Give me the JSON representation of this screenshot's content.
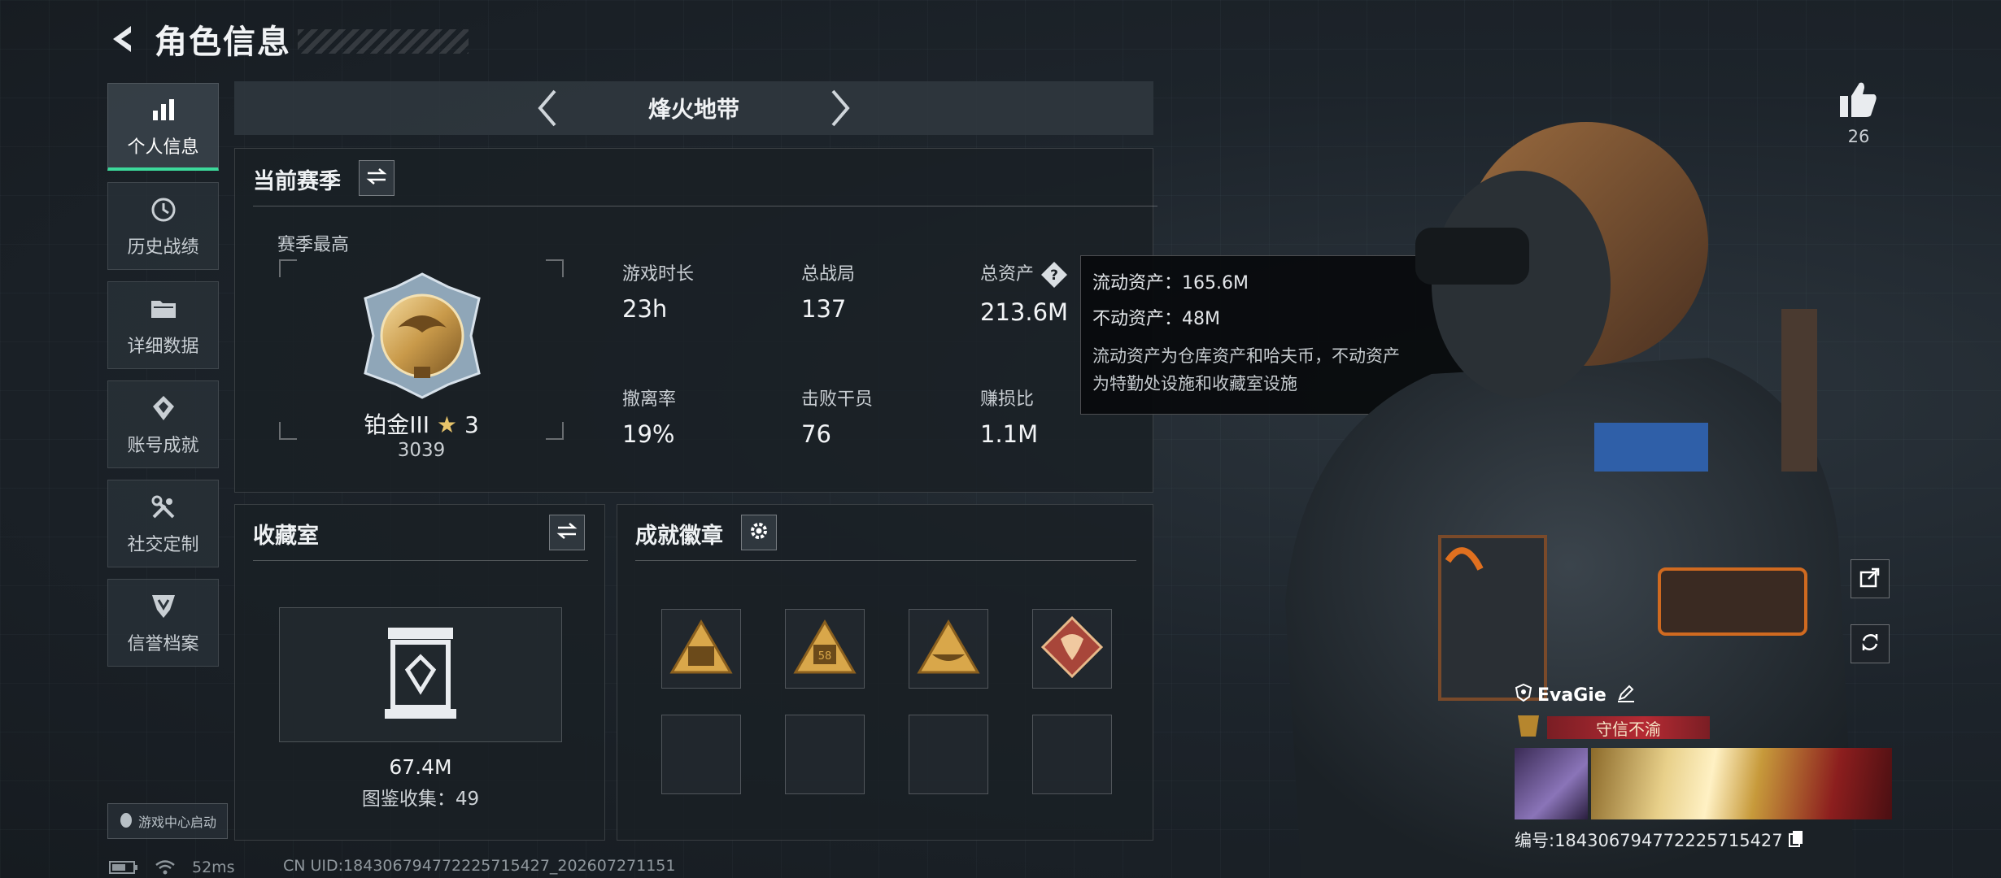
{
  "header": {
    "title": "角色信息"
  },
  "sidebar": {
    "items": [
      {
        "label": "个人信息",
        "icon": "bar-chart-icon",
        "active": true
      },
      {
        "label": "历史战绩",
        "icon": "history-icon",
        "active": false
      },
      {
        "label": "详细数据",
        "icon": "folder-icon",
        "active": false
      },
      {
        "label": "账号成就",
        "icon": "achievement-icon",
        "active": false
      },
      {
        "label": "社交定制",
        "icon": "tools-icon",
        "active": false
      },
      {
        "label": "信誉档案",
        "icon": "shield-icon",
        "active": false
      }
    ],
    "game_center_label": "游戏中心启动"
  },
  "mode_bar": {
    "mode_name": "烽火地带"
  },
  "season": {
    "title": "当前赛季",
    "best_label": "赛季最高",
    "rank_name": "铂金III",
    "rank_stars": "3",
    "rank_score": "3039",
    "stats": [
      {
        "label": "游戏时长",
        "value": "23h"
      },
      {
        "label": "总战局",
        "value": "137"
      },
      {
        "label": "总资产",
        "value": "213.6M"
      },
      {
        "label": "撤离率",
        "value": "19%"
      },
      {
        "label": "击败干员",
        "value": "76"
      },
      {
        "label": "赚损比",
        "value": "1.1M"
      }
    ]
  },
  "tooltip": {
    "liquid": "流动资产：165.6M",
    "fixed": "不动资产：48M",
    "desc_line1": "流动资产为仓库资产和哈夫币，不动资产",
    "desc_line2": "为特勤处设施和收藏室设施"
  },
  "collection": {
    "title": "收藏室",
    "value": "67.4M",
    "count": "图鉴收集：49"
  },
  "badges": {
    "title": "成就徽章",
    "slots": [
      "badge-soldiers",
      "badge-58",
      "badge-boat",
      "badge-dragon",
      "",
      "",
      "",
      ""
    ]
  },
  "profile": {
    "likes": "26",
    "name": "EvaGie",
    "title": "守信不渝",
    "uid": "编号:1843067947722257154​27"
  },
  "status": {
    "ping": "52ms",
    "footer_uid": "CN UID:184306794772225715427_202607271151"
  },
  "colors": {
    "accent": "#3cd99b",
    "title_red": "#b52a33",
    "gold": "#d9a74a"
  }
}
